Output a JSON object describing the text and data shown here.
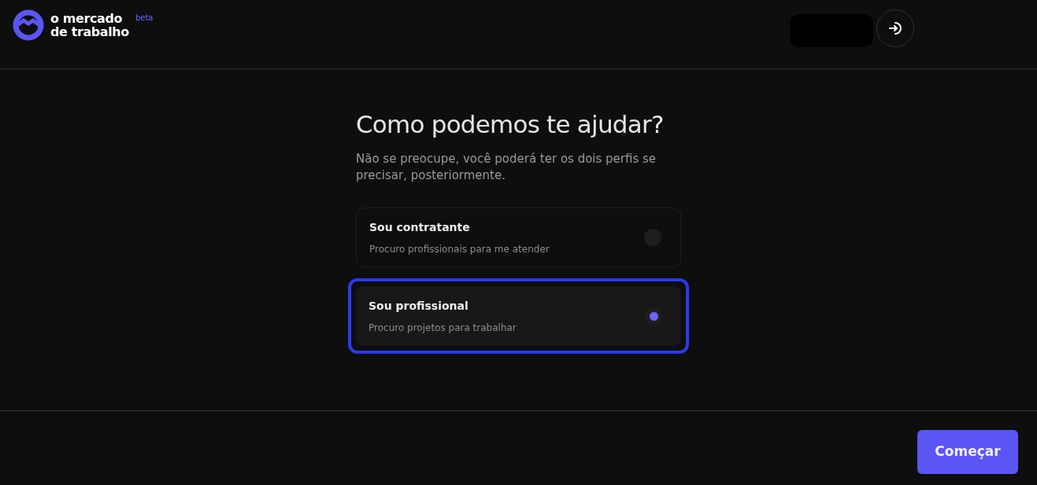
{
  "header": {
    "logo_line_1": "o mercado",
    "logo_line_2": "de trabalho",
    "badge": "beta"
  },
  "title": "Como podemos te ajudar?",
  "subtitle": "Não se preocupe, você poderá ter os dois perfis se precisar, posteriormente.",
  "options": [
    {
      "title": "Sou contratante",
      "description": "Procuro profissionais para me atender",
      "selected": false
    },
    {
      "title": "Sou profissional",
      "description": "Procuro projetos para trabalhar",
      "selected": true
    }
  ],
  "footer": {
    "button": "Começar"
  }
}
